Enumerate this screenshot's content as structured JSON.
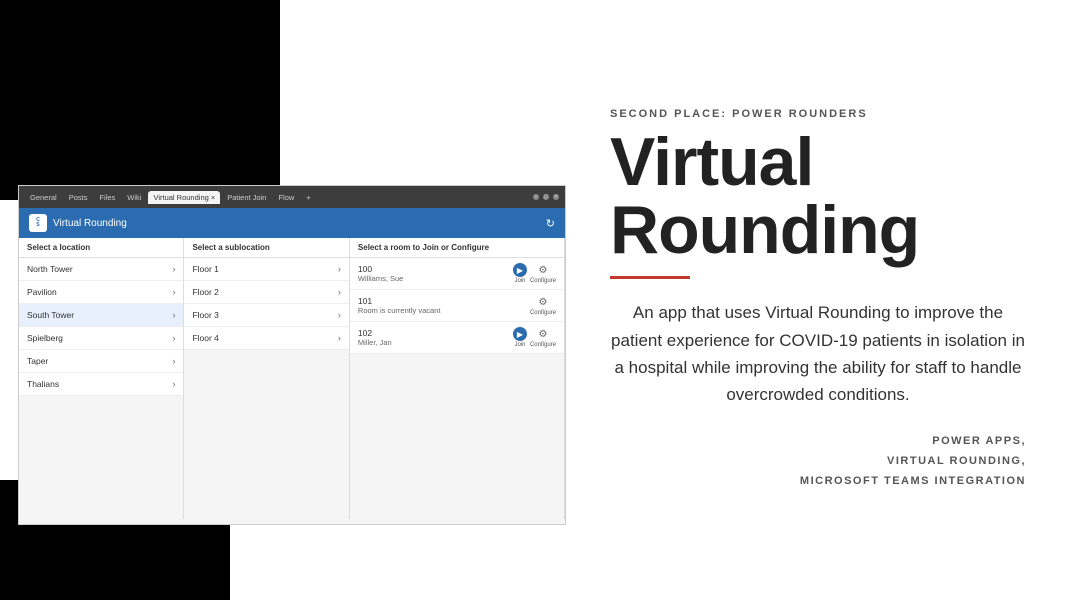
{
  "header": {
    "subtitle": "SECOND PLACE: POWER ROUNDERS",
    "title": "Virtual Rounding",
    "divider_color": "#c0392b"
  },
  "description": "An app that uses Virtual Rounding to improve the patient experience for COVID-19 patients in isolation in a hospital while improving the ability for staff to handle overcrowded conditions.",
  "tags": [
    "POWER APPS,",
    "VIRTUAL ROUNDING,",
    "MICROSOFT TEAMS INTEGRATION"
  ],
  "app": {
    "title": "Virtual Rounding",
    "logo_text": "CS",
    "teams_tabs": [
      "General",
      "Posts",
      "Files",
      "Wiki",
      "Virtual Rounding ×",
      "Patient Join",
      "Flow",
      "+"
    ],
    "col_headers": [
      "Select a location",
      "Select a sublocation",
      "Select a room to Join or Configure"
    ],
    "locations": [
      {
        "name": "North Tower",
        "selected": false
      },
      {
        "name": "Pavilion",
        "selected": false
      },
      {
        "name": "South Tower",
        "selected": true
      },
      {
        "name": "Spielberg",
        "selected": false
      },
      {
        "name": "Taper",
        "selected": false
      },
      {
        "name": "Thalians",
        "selected": false
      }
    ],
    "sublocations": [
      {
        "name": "Floor 1"
      },
      {
        "name": "Floor 2"
      },
      {
        "name": "Floor 3"
      },
      {
        "name": "Floor 4"
      }
    ],
    "rooms": [
      {
        "number": "100",
        "patient": "Williams, Sue",
        "vacant": false,
        "join": true,
        "configure": true
      },
      {
        "number": "101",
        "patient": "Room is currently vacant",
        "vacant": true,
        "join": false,
        "configure": true
      },
      {
        "number": "102",
        "patient": "Miller, Jan",
        "vacant": false,
        "join": true,
        "configure": true
      }
    ]
  }
}
